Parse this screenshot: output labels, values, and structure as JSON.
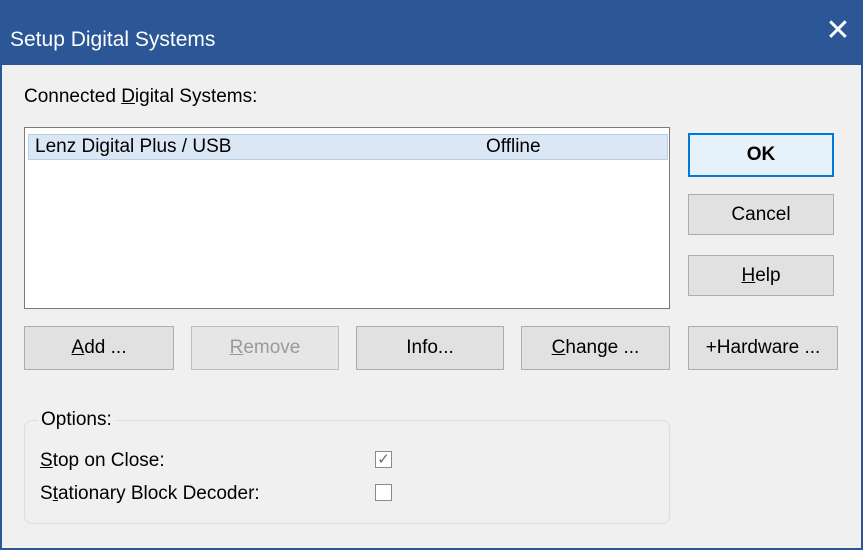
{
  "window": {
    "title": "Setup Digital Systems"
  },
  "connected_label": {
    "before": "Connected ",
    "mnemonic": "D",
    "after": "igital Systems:"
  },
  "systems": [
    {
      "name": "Lenz Digital Plus / USB",
      "status": "Offline"
    }
  ],
  "buttons": {
    "ok": "OK",
    "cancel": "Cancel",
    "help": {
      "mnemonic": "H",
      "rest": "elp"
    },
    "add": {
      "mnemonic": "A",
      "rest": "dd ..."
    },
    "remove": {
      "mnemonic": "R",
      "rest": "emove"
    },
    "info": "Info...",
    "change": {
      "mnemonic": "C",
      "rest": "hange ..."
    },
    "hardware": "+Hardware ..."
  },
  "options": {
    "title": "Options:",
    "stop_on_close": {
      "mnemonic": "S",
      "rest": "top on Close:",
      "checked": true
    },
    "stationary": {
      "before": "S",
      "mnemonic": "t",
      "after": "ationary Block Decoder:",
      "checked": false
    }
  },
  "icons": {
    "close": "close-icon",
    "checkmark": "checkmark-icon"
  },
  "colors": {
    "titlebar": "#2b5797",
    "selection": "#dce7f6",
    "default_button_border": "#0078d7"
  }
}
